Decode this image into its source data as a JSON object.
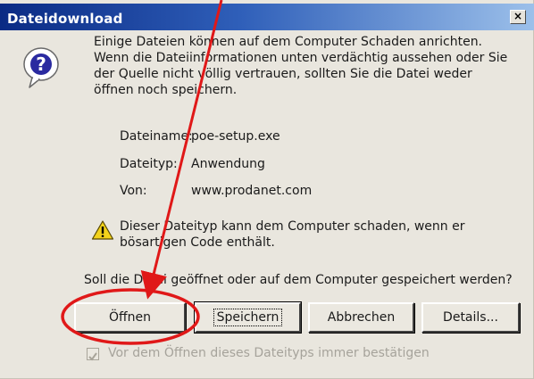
{
  "dialog": {
    "title": "Dateidownload",
    "close_symbol": "×",
    "message": "Einige Dateien können auf dem Computer Schaden anrichten. Wenn die Dateiinformationen unten verdächtig aussehen oder Sie der Quelle nicht völlig vertrauen, sollten Sie die Datei weder öffnen noch speichern.",
    "file_info": {
      "name_label": "Dateiname:",
      "name_value": "poe-setup.exe",
      "type_label": "Dateityp:",
      "type_value": "Anwendung",
      "from_label": "Von:",
      "from_value": "www.prodanet.com"
    },
    "warning": "Dieser Dateityp kann dem Computer schaden, wenn er bösartigen Code enthält.",
    "question": "Soll die Datei geöffnet oder auf dem Computer gespeichert werden?",
    "buttons": {
      "open": "Öffnen",
      "save": "Speichern",
      "cancel": "Abbrechen",
      "details": "Details..."
    },
    "checkbox": {
      "label": "Vor dem Öffnen dieses Dateityps immer bestätigen",
      "checked": true,
      "disabled": true
    }
  },
  "icons": {
    "question": "question-icon",
    "warning": "warning-icon"
  },
  "colors": {
    "titlebar_start": "#0a2a84",
    "titlebar_end": "#9cc0ea",
    "dialog_bg": "#e9e6de",
    "annotation_red": "#e01818"
  }
}
